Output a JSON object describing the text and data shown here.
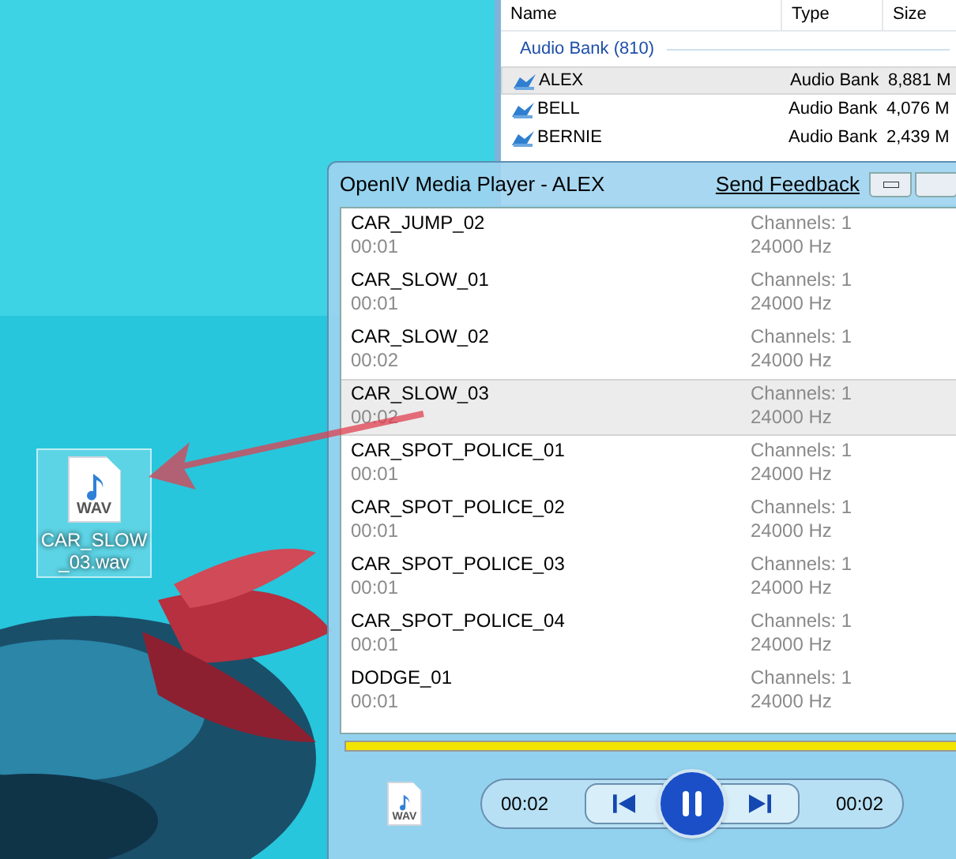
{
  "explorer": {
    "columns": [
      "Name",
      "Type",
      "Size"
    ],
    "group": "Audio Bank (810)",
    "rows": [
      {
        "name": "ALEX",
        "type": "Audio Bank",
        "size": "8,881 M",
        "selected": true
      },
      {
        "name": "BELL",
        "type": "Audio Bank",
        "size": "4,076 M",
        "selected": false
      },
      {
        "name": "BERNIE",
        "type": "Audio Bank",
        "size": "2,439 M",
        "selected": false
      }
    ]
  },
  "player": {
    "title": "OpenIV Media Player - ALEX",
    "feedback": "Send Feedback",
    "tracks": [
      {
        "name": "CAR_JUMP_02",
        "duration": "00:01",
        "channels": "Channels: 1",
        "rate": "24000 Hz",
        "selected": false
      },
      {
        "name": "CAR_SLOW_01",
        "duration": "00:01",
        "channels": "Channels: 1",
        "rate": "24000 Hz",
        "selected": false
      },
      {
        "name": "CAR_SLOW_02",
        "duration": "00:02",
        "channels": "Channels: 1",
        "rate": "24000 Hz",
        "selected": false
      },
      {
        "name": "CAR_SLOW_03",
        "duration": "00:02",
        "channels": "Channels: 1",
        "rate": "24000 Hz",
        "selected": true
      },
      {
        "name": "CAR_SPOT_POLICE_01",
        "duration": "00:01",
        "channels": "Channels: 1",
        "rate": "24000 Hz",
        "selected": false
      },
      {
        "name": "CAR_SPOT_POLICE_02",
        "duration": "00:01",
        "channels": "Channels: 1",
        "rate": "24000 Hz",
        "selected": false
      },
      {
        "name": "CAR_SPOT_POLICE_03",
        "duration": "00:01",
        "channels": "Channels: 1",
        "rate": "24000 Hz",
        "selected": false
      },
      {
        "name": "CAR_SPOT_POLICE_04",
        "duration": "00:01",
        "channels": "Channels: 1",
        "rate": "24000 Hz",
        "selected": false
      },
      {
        "name": "DODGE_01",
        "duration": "00:01",
        "channels": "Channels: 1",
        "rate": "24000 Hz",
        "selected": false
      }
    ],
    "progress": {
      "level": 1
    },
    "file_label": "WAV",
    "elapsed": "00:02",
    "total": "00:02",
    "playing": true
  },
  "desktop_icon": {
    "label": "CAR_SLOW_03.wav",
    "file_label": "WAV"
  }
}
